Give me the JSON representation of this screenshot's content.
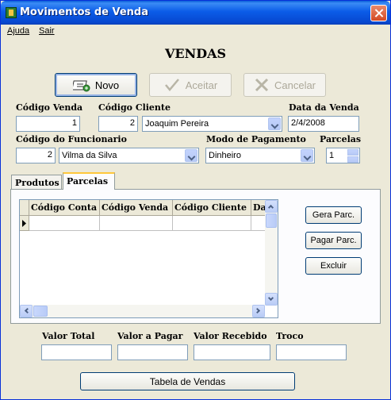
{
  "window": {
    "title": "Movimentos de Venda",
    "title_icon": "app-icon",
    "close_icon": "close-icon"
  },
  "menu": {
    "items": [
      "Ajuda",
      "Sair"
    ]
  },
  "heading": "VENDAS",
  "toolbar": {
    "novo_label": "Novo",
    "aceitar_label": "Aceitar",
    "cancelar_label": "Cancelar"
  },
  "form": {
    "codigo_venda": {
      "label": "Código Venda",
      "value": "1"
    },
    "codigo_cliente": {
      "label": "Código Cliente",
      "value": "2",
      "name": "Joaquim Pereira"
    },
    "data_venda": {
      "label": "Data da Venda",
      "value": "2/4/2008"
    },
    "codigo_funcionario": {
      "label": "Código do Funcionario",
      "value": "2",
      "name": "Vilma da Silva"
    },
    "modo_pagamento": {
      "label": "Modo de Pagamento",
      "value": "Dinheiro"
    },
    "parcelas": {
      "label": "Parcelas",
      "value": "1"
    }
  },
  "tabs": [
    {
      "label": "Produtos",
      "active": false
    },
    {
      "label": "Parcelas",
      "active": true
    }
  ],
  "grid": {
    "columns": [
      "Código Conta",
      "Código Venda",
      "Código Cliente",
      "Da"
    ],
    "rows": []
  },
  "side_buttons": {
    "gera_parc": "Gera Parc.",
    "pagar_parc": "Pagar Parc.",
    "excluir": "Excluir"
  },
  "totals": {
    "valor_total": {
      "label": "Valor Total",
      "value": ""
    },
    "valor_pagar": {
      "label": "Valor a Pagar",
      "value": ""
    },
    "valor_recebido": {
      "label": "Valor Recebido",
      "value": ""
    },
    "troco": {
      "label": "Troco",
      "value": ""
    }
  },
  "bottom_button": "Tabela de Vendas",
  "colors": {
    "titlebar": "#0b5ce8",
    "window_bg": "#ece9d8",
    "tab_highlight": "#ffc83c"
  }
}
